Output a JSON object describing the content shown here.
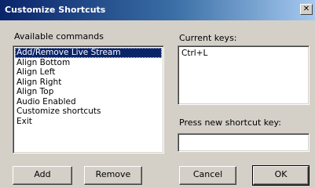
{
  "window": {
    "title": "Customize Shortcuts",
    "close_glyph": "✕"
  },
  "commands": {
    "label": "Available commands",
    "selected_index": 0,
    "items": [
      "Add/Remove Live Stream",
      "Align Bottom",
      "Align Left",
      "Align Right",
      "Align Top",
      "Audio Enabled",
      "Customize shortcuts",
      "Exit"
    ]
  },
  "current_keys": {
    "label": "Current keys:",
    "items": [
      "Ctrl+L"
    ]
  },
  "new_key": {
    "label": "Press new shortcut key:",
    "value": ""
  },
  "buttons": {
    "add": "Add",
    "remove": "Remove",
    "cancel": "Cancel",
    "ok": "OK"
  }
}
